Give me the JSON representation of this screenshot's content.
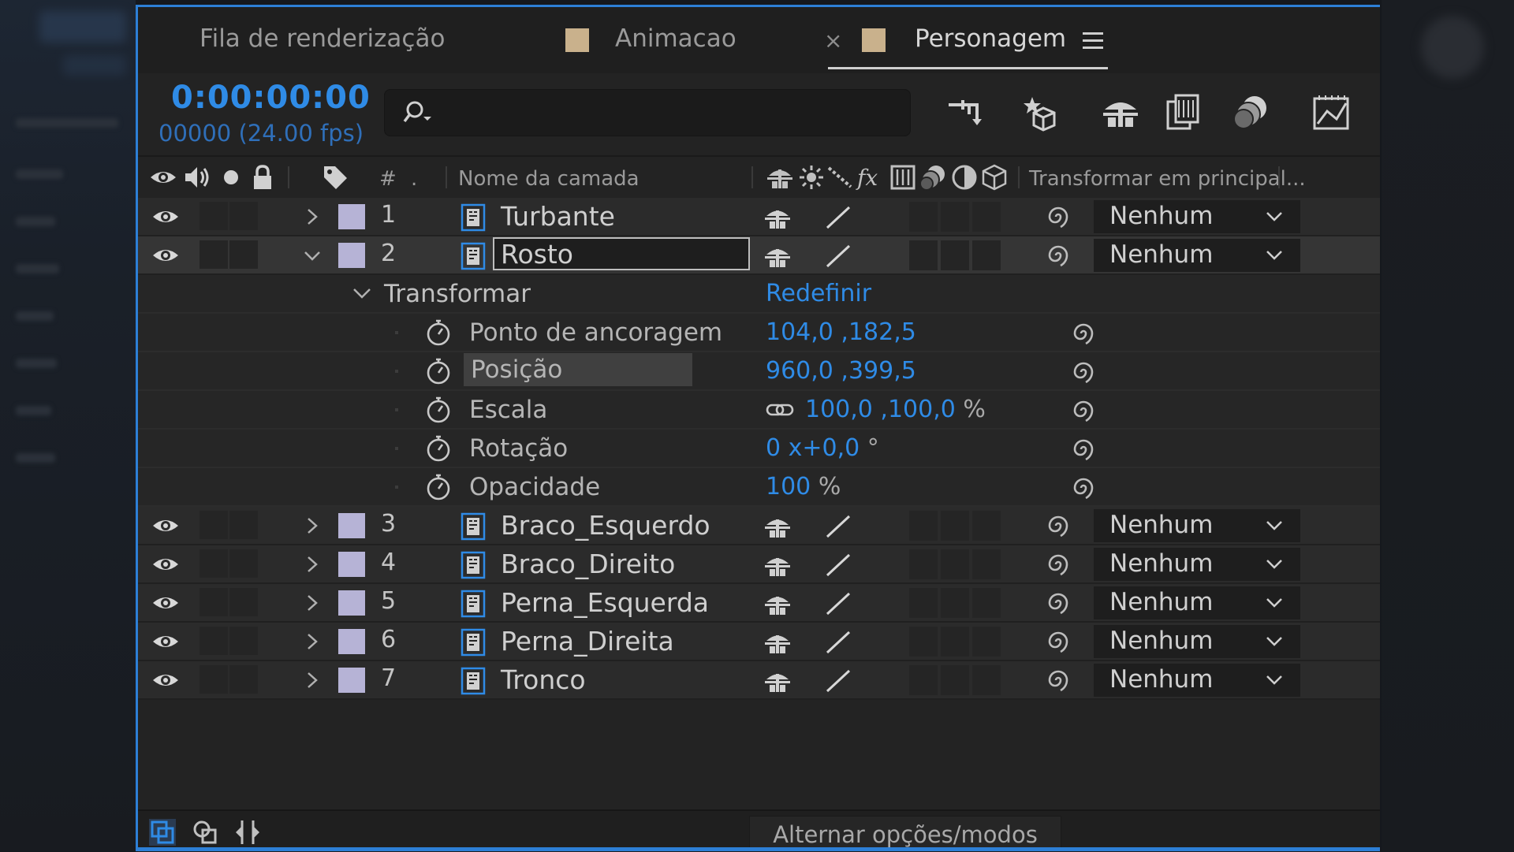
{
  "tabs": [
    {
      "label": "Fila de renderização"
    },
    {
      "label": "Animacao"
    },
    {
      "label": "Personagem",
      "active": true
    }
  ],
  "tab_close": "×",
  "timecode": "0:00:00:00",
  "frame_info": "00000 (24.00 fps)",
  "search": {
    "placeholder": ""
  },
  "columns": {
    "hash": "#",
    "dot": ".",
    "layer_name": "Nome da camada",
    "parent": "Transformar em principal..."
  },
  "layers": [
    {
      "num": "1",
      "name": "Turbante",
      "parent": "Nenhum"
    },
    {
      "num": "2",
      "name": "Rosto",
      "parent": "Nenhum",
      "selected": true,
      "expanded": true
    },
    {
      "num": "3",
      "name": "Braco_Esquerdo",
      "parent": "Nenhum"
    },
    {
      "num": "4",
      "name": "Braco_Direito",
      "parent": "Nenhum"
    },
    {
      "num": "5",
      "name": "Perna_Esquerda",
      "parent": "Nenhum"
    },
    {
      "num": "6",
      "name": "Perna_Direita",
      "parent": "Nenhum"
    },
    {
      "num": "7",
      "name": "Tronco",
      "parent": "Nenhum"
    }
  ],
  "transform": {
    "label": "Transformar",
    "reset": "Redefinir",
    "properties": [
      {
        "name": "Ponto de ancoragem",
        "value": "104,0 ,182,5",
        "unit": ""
      },
      {
        "name": "Posição",
        "value": "960,0 ,399,5",
        "unit": ""
      },
      {
        "name": "Escala",
        "value": "100,0 ,100,0",
        "unit": "%"
      },
      {
        "name": "Rotação",
        "value": "0 x+0,0",
        "unit": "°"
      },
      {
        "name": "Opacidade",
        "value": "100",
        "unit": "%"
      }
    ]
  },
  "bottom": {
    "toggle_label": "Alternar opções/modos"
  },
  "colors": {
    "accent": "#2f8be6",
    "label": "#b6b3d6",
    "swatch": "#c9b18c"
  }
}
